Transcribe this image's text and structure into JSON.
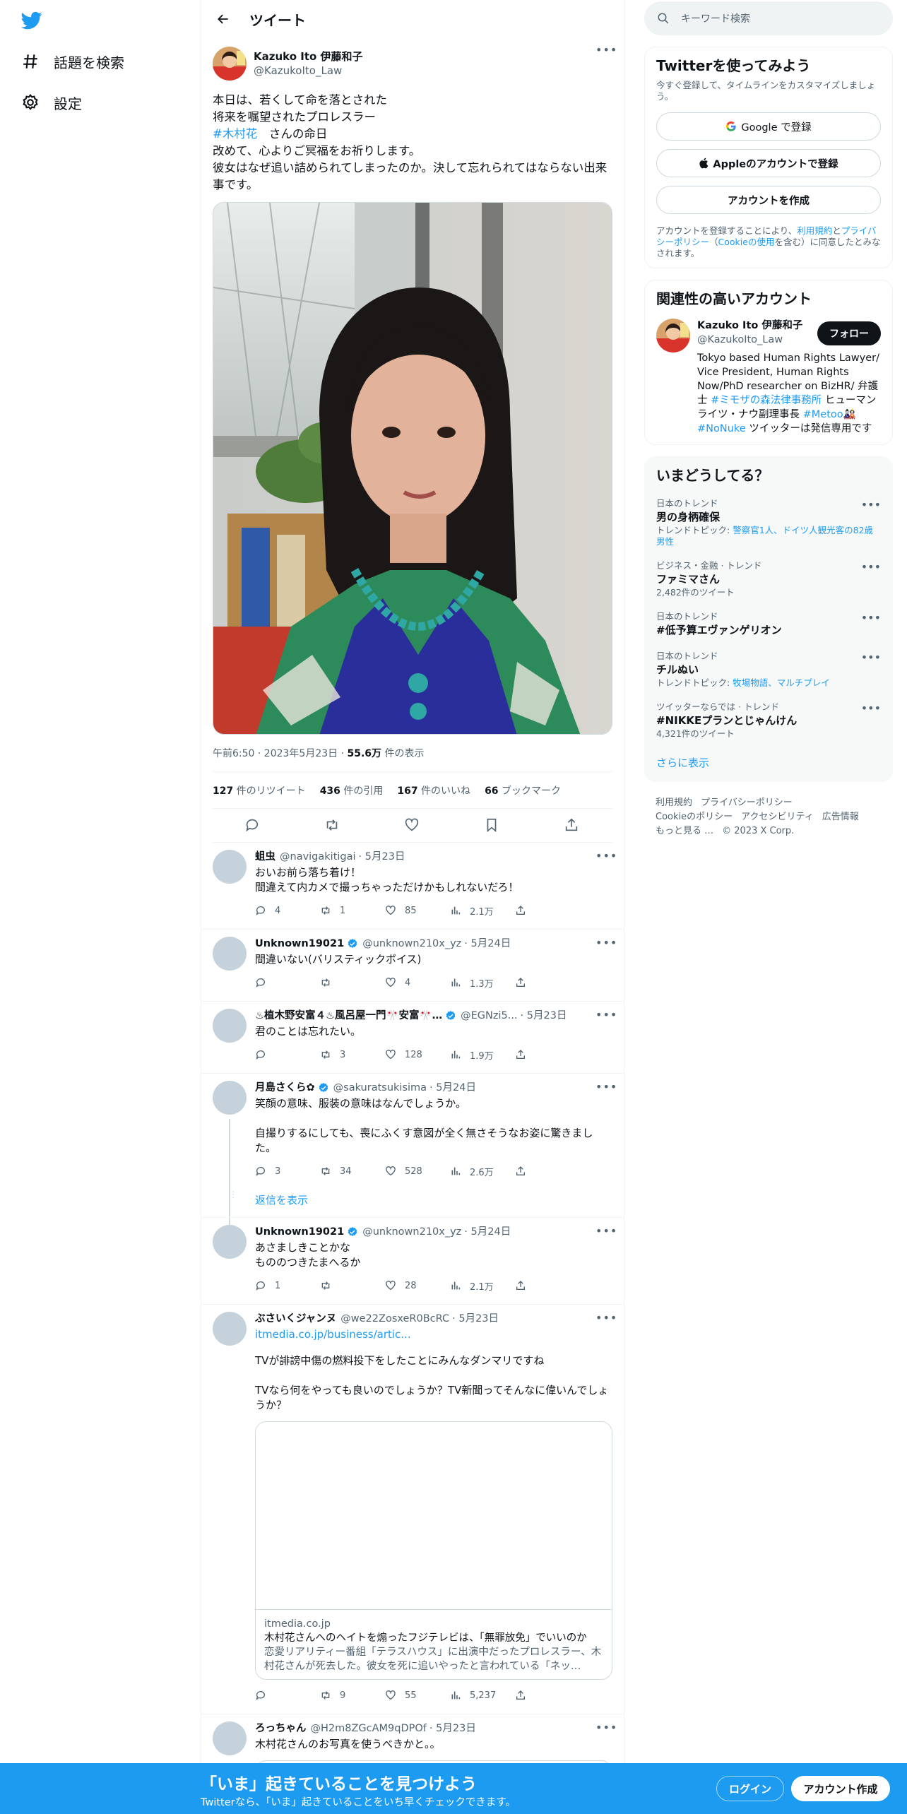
{
  "nav": {
    "explore_label": "話題を検索",
    "settings_label": "設定"
  },
  "header": {
    "title": "ツイート"
  },
  "main_tweet": {
    "author_name": "Kazuko Ito 伊藤和子",
    "author_handle": "@KazukoIto_Law",
    "text_line1": "本日は、若くして命を落とされた",
    "text_line2": "将来を嘱望されたプロレスラー",
    "hashtag": "#木村花",
    "text_line3": "　さんの命日",
    "text_line4": "改めて、心よりご冥福をお祈りします。",
    "text_line5": "彼女はなぜ追い詰められてしまったのか。決して忘れられてはならない出来事です。",
    "time": "午前6:50 · 2023年5月23日 · ",
    "views_count": "55.6万",
    "views_label": " 件の表示",
    "retweets_count": "127",
    "retweets_label": " 件のリツイート",
    "quotes_count": "436",
    "quotes_label": " 件の引用",
    "likes_count": "167",
    "likes_label": " 件のいいね",
    "bookmarks_count": "66",
    "bookmarks_label": " ブックマーク"
  },
  "replies": [
    {
      "name": "蛆虫",
      "handle": "@navigakitigai",
      "date": "· 5月23日",
      "text": "おいお前ら落ち着け！\n間違えて内カメで撮っちゃっただけかもしれないだろ！",
      "reply": "4",
      "retweet": "1",
      "like": "85",
      "views": "2.1万"
    },
    {
      "name": "Unknown19021",
      "handle": "@unknown210x_yz",
      "date": "· 5月24日",
      "text": "間違いない(バリスティックボイス)",
      "reply": "",
      "retweet": "",
      "like": "4",
      "views": "1.3万"
    },
    {
      "name": "♨植木野安富４♨風呂屋一門🎌安富🎌…",
      "handle": "@EGNzi5...",
      "date": "· 5月23日",
      "text": "君のことは忘れたい。",
      "reply": "",
      "retweet": "3",
      "like": "128",
      "views": "1.9万"
    },
    {
      "name": "月島さくら✿",
      "handle": "@sakuratsukisima",
      "date": "· 5月24日",
      "text": "笑顔の意味、服装の意味はなんでしょうか。\n\n自撮りするにしても、喪にふくす意図が全く無さそうなお姿に驚きました。",
      "reply": "3",
      "retweet": "34",
      "like": "528",
      "views": "2.6万"
    },
    {
      "name": "Unknown19021",
      "handle": "@unknown210x_yz",
      "date": "· 5月24日",
      "text": "あさましきことかな\nもののつきたまへるか",
      "reply": "1",
      "retweet": "",
      "like": "28",
      "views": "2.1万"
    },
    {
      "name": "ぶさいくジャンヌ",
      "handle": "@we22ZosxeR0BcRC",
      "date": "· 5月23日",
      "link": "itmedia.co.jp/business/artic...",
      "text": "TVが誹謗中傷の燃料投下をしたことにみんなダンマリですね\n\nTVなら何をやっても良いのでしょうか？TV新聞ってそんなに偉いんでしょうか？",
      "reply": "",
      "retweet": "9",
      "like": "55",
      "views": "5,237"
    },
    {
      "name": "ろっちゃん",
      "handle": "@H2m8ZGcAM9qDPOf",
      "date": "· 5月23日",
      "text": "木村花さんのお写真を使うべきかと。。"
    }
  ],
  "show_replies": "返信を表示",
  "card": {
    "domain": "itmedia.co.jp",
    "title": "木村花さんへのヘイトを煽ったフジテレビは、「無罪放免」でいいのか",
    "desc": "恋愛リアリティー番組「テラスハウス」に出演中だったプロレスラー、木村花さんが死去した。彼女を死に追いやったと言われている「ネッ…"
  },
  "right": {
    "search_placeholder": "キーワード検索",
    "signup_title": "Twitterを使ってみよう",
    "signup_sub": "今すぐ登録して、タイムラインをカスタマイズしましょう。",
    "google_btn": "Google で登録",
    "apple_btn": "Appleのアカウントで登録",
    "create_btn": "アカウントを作成",
    "terms_pre": "アカウントを登録することにより、",
    "terms_link1": "利用規約",
    "terms_mid": "と",
    "terms_link2": "プライバシーポリシー",
    "terms_paren_open": "（",
    "terms_link3": "Cookieの使用",
    "terms_post": "を含む）に同意したとみなされます。",
    "related_title": "関連性の高いアカウント",
    "related_name": "Kazuko Ito 伊藤和子",
    "related_handle": "@KazukoIto_Law",
    "follow_btn": "フォロー",
    "bio_1": "Tokyo based Human Rights Lawyer/ Vice President, Human Rights Now/PhD researcher on BizHR/ 弁護士 ",
    "bio_tag1": "#ミモザの森法律事務所",
    "bio_2": " ヒューマンライツ・ナウ副理事長 ",
    "bio_tag2": "#Metoo",
    "bio_3": "🎎 ",
    "bio_tag3": "#NoNuke",
    "bio_4": " ツイッターは発信専用です",
    "trends_title": "いまどうしてる？",
    "trends": [
      {
        "context": "日本のトレンド",
        "name": "男の身柄確保",
        "extra_pre": "トレンドトピック: ",
        "extra_link": "警察官1人、ドイツ人観光客の82歳男性"
      },
      {
        "context": "ビジネス・金融 · トレンド",
        "name": "ファミマさん",
        "extra_pre": "2,482件のツイート",
        "extra_link": ""
      },
      {
        "context": "日本のトレンド",
        "name": "#低予算エヴァンゲリオン",
        "extra_pre": "",
        "extra_link": ""
      },
      {
        "context": "日本のトレンド",
        "name": "チルぬい",
        "extra_pre": "トレンドトピック: ",
        "extra_link": "牧場物語、マルチプレイ"
      },
      {
        "context": "ツイッターならでは · トレンド",
        "name": "#NIKKEプランとじゃんけん",
        "extra_pre": "4,321件のツイート",
        "extra_link": ""
      }
    ],
    "show_more": "さらに表示",
    "footer": [
      "利用規約",
      "プライバシーポリシー",
      "Cookieのポリシー",
      "アクセシビリティ",
      "広告情報",
      "もっと見る …",
      "© 2023 X Corp."
    ]
  },
  "bottom": {
    "title": "「いま」起きていることを見つけよう",
    "subtitle": "Twitterなら、「いま」起きていることをいち早くチェックできます。",
    "login": "ログイン",
    "signup": "アカウント作成"
  },
  "colors": {
    "accent": "#1d9bf0",
    "text": "#0f1419",
    "secondary": "#536471"
  }
}
